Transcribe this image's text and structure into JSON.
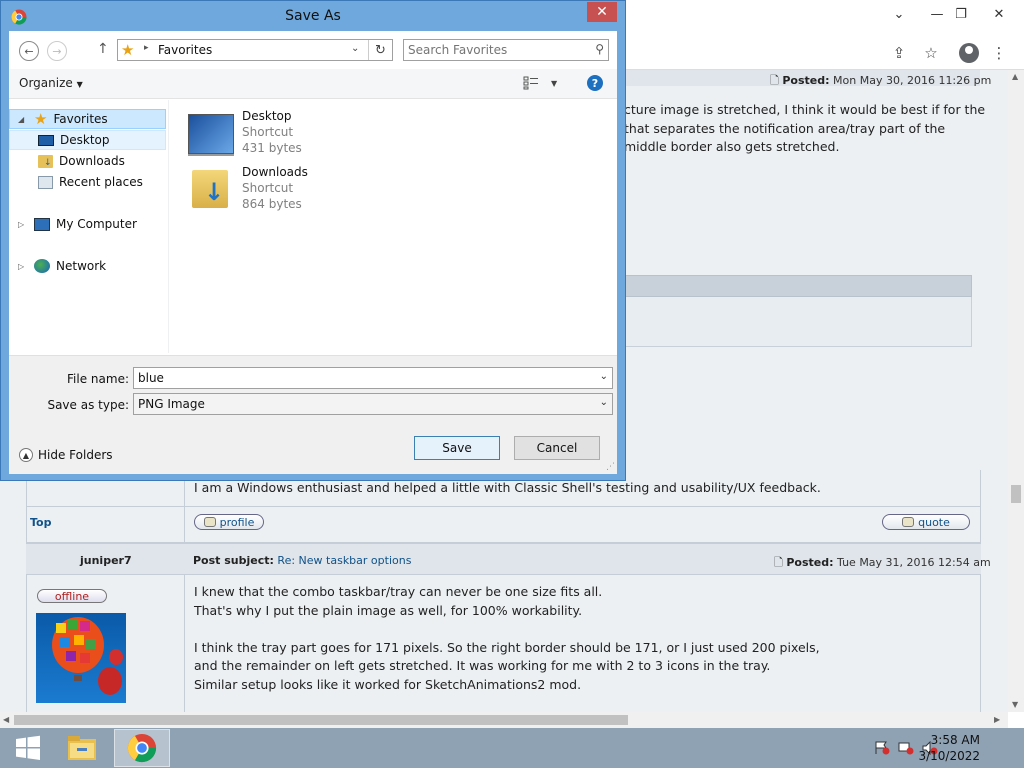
{
  "browser": {
    "posted1": {
      "label": "Posted:",
      "value": "Mon May 30, 2016 11:26 pm"
    },
    "post1_lines": [
      "cture image is stretched, I think it would be best if for the",
      "that separates the notification area/tray part of the",
      "middle border also gets stretched."
    ],
    "signature_line": "I am a Windows enthusiast and helped a little with Classic Shell's testing and usability/UX feedback.",
    "top_link": "Top",
    "profile_button": "profile",
    "quote_button": "quote",
    "post2": {
      "author": "juniper7",
      "subject_label": "Post subject:",
      "subject_value": "Re: New taskbar options",
      "posted_label": "Posted:",
      "posted_value": "Tue May 31, 2016 12:54 am",
      "status": "offline",
      "lines": [
        "I knew that the combo taskbar/tray can never be one size fits all.",
        "That's why I put the plain image as well, for 100% workability.",
        "",
        "I think the tray part goes for 171 pixels. So the right border should be 171, or I just used 200 pixels,",
        "and the remainder on left gets stretched. It was working for me with 2 to 3 icons in the tray.",
        "Similar setup looks like it worked for SketchAnimations2 mod."
      ]
    }
  },
  "dialog": {
    "title": "Save As",
    "address": "Favorites",
    "search_placeholder": "Search Favorites",
    "organize_label": "Organize",
    "tree": {
      "favorites": "Favorites",
      "desktop": "Desktop",
      "downloads": "Downloads",
      "recent": "Recent places",
      "computer": "My Computer",
      "network": "Network"
    },
    "files": [
      {
        "name": "Desktop",
        "type": "Shortcut",
        "size": "431 bytes"
      },
      {
        "name": "Downloads",
        "type": "Shortcut",
        "size": "864 bytes"
      }
    ],
    "file_name_label": "File name:",
    "file_name_value": "blue",
    "save_type_label": "Save as type:",
    "save_type_value": "PNG Image",
    "save_button": "Save",
    "cancel_button": "Cancel",
    "hide_folders": "Hide Folders"
  },
  "taskbar": {
    "time": "3:58 AM",
    "date": "3/10/2022"
  },
  "colors": {
    "dialog_frame": "#6fa8dc",
    "close_button": "#c75050",
    "selection": "#cce8ff",
    "taskbar": "#8fa2b4",
    "forum_link": "#105289"
  }
}
